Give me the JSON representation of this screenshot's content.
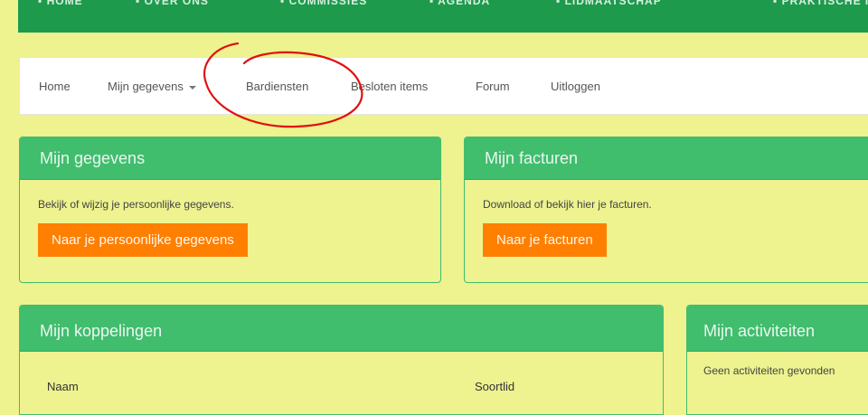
{
  "topbar": {
    "items": [
      "▪ HOME",
      "▪ OVER ONS",
      "▪ COMMISSIES",
      "▪ AGENDA",
      "▪ LIDMAATSCHAP",
      "▪ PRAKTISCHE INFO"
    ],
    "color": "#1e9a4d"
  },
  "nav": {
    "home": "Home",
    "mijn_gegevens": "Mijn gegevens",
    "bardiensten": "Bardiensten",
    "besloten_items": "Besloten items",
    "forum": "Forum",
    "uitloggen": "Uitloggen"
  },
  "panels": {
    "gegevens": {
      "title": "Mijn gegevens",
      "text": "Bekijk of wijzig je persoonlijke gegevens.",
      "button": "Naar je persoonlijke gegevens"
    },
    "facturen": {
      "title": "Mijn facturen",
      "text": "Download of bekijk hier je facturen.",
      "button": "Naar je facturen"
    },
    "koppelingen": {
      "title": "Mijn koppelingen",
      "col_naam": "Naam",
      "col_soortlid": "Soortlid"
    },
    "activiteiten": {
      "title": "Mijn activiteiten",
      "text": "Geen activiteiten gevonden"
    }
  },
  "colors": {
    "page_bg": "#eef28f",
    "panel_header": "#41bd6e",
    "button": "#ff7f00",
    "annotation": "#e01010"
  },
  "icons": {
    "dropdown": "caret-down-icon"
  }
}
